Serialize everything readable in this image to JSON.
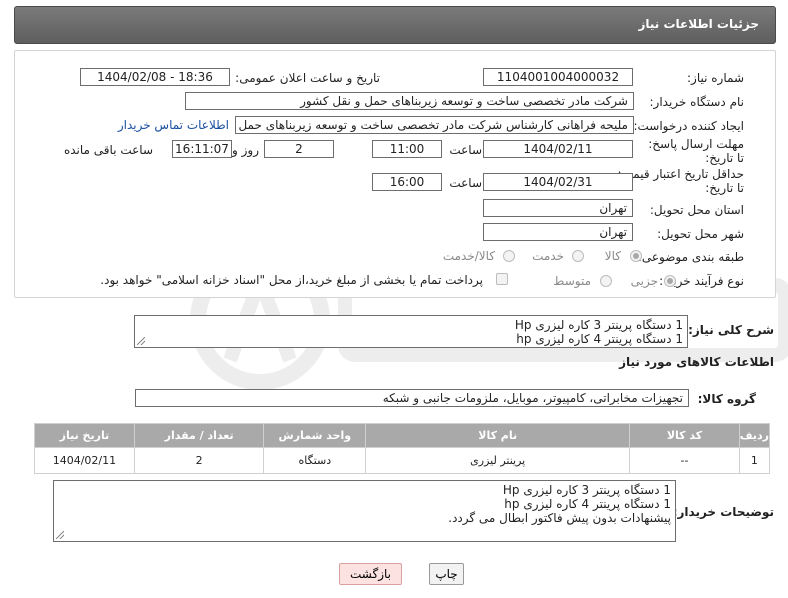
{
  "header": {
    "title": "جزئیات اطلاعات نیاز"
  },
  "labels": {
    "need_number": "شماره نیاز:",
    "announce_datetime": "تاریخ و ساعت اعلان عمومی:",
    "buyer_org": "نام دستگاه خریدار:",
    "requester": "ایجاد کننده درخواست:",
    "reply_deadline": "مهلت ارسال پاسخ: تا تاریخ:",
    "time": "ساعت",
    "days_and": "روز و",
    "hours_remaining": "ساعت باقی مانده",
    "price_validity": "حداقل تاریخ اعتبار قیمت: تا تاریخ:",
    "province": "استان محل تحویل:",
    "city": "شهر محل تحویل:",
    "category": "طبقه بندی موضوعی:",
    "process_type": "نوع فرآیند خرید :",
    "general_desc": "شرح کلی نیاز:",
    "goods_info": "اطلاعات کالاهای مورد نیاز",
    "goods_group": "گروه کالا:",
    "buyer_notes": "توضیحات خریدار:"
  },
  "values": {
    "need_number": "1104001004000032",
    "announce_datetime": "1404/02/08 - 18:36",
    "buyer_org": "شرکت مادر تخصصی ساخت و توسعه زیربناهای حمل و نقل کشور",
    "requester": "ملیحه فراهانی کارشناس شرکت مادر تخصصی ساخت و توسعه زیربناهای حمل و نقل",
    "contact_link": "اطلاعات تماس خریدار",
    "reply_date": "1404/02/11",
    "reply_time": "11:00",
    "days": "2",
    "remaining": "16:11:07",
    "validity_date": "1404/02/31",
    "validity_time": "16:00",
    "province": "تهران",
    "city": "تهران"
  },
  "category_options": [
    {
      "label": "کالا",
      "selected": true
    },
    {
      "label": "خدمت",
      "selected": false
    },
    {
      "label": "کالا/خدمت",
      "selected": false
    }
  ],
  "process_options": [
    {
      "label": "جزیی",
      "selected": true
    },
    {
      "label": "متوسط",
      "selected": false
    }
  ],
  "payment_note": "پرداخت تمام یا بخشی از مبلغ خرید،از محل \"اسناد خزانه اسلامی\" خواهد بود.",
  "general_desc_lines": [
    "1 دستگاه پرینتر 3 کاره لیزری Hp",
    "1 دستگاه پرینتر 4 کاره لیزری hp"
  ],
  "goods_group_value": "تجهیزات مخابراتی، کامپیوتر، موبایل، ملزومات جانبی و شبکه",
  "table": {
    "headers": [
      "ردیف",
      "کد کالا",
      "نام کالا",
      "واحد شمارش",
      "تعداد / مقدار",
      "تاریخ نیاز"
    ],
    "rows": [
      [
        "1",
        "--",
        "پرینتر لیزری",
        "دستگاه",
        "2",
        "1404/02/11"
      ]
    ]
  },
  "buyer_notes_lines": [
    "1 دستگاه پرینتر 3 کاره لیزری Hp",
    "1 دستگاه پرینتر 4 کاره لیزری hp",
    "پیشنهادات بدون پیش فاکتور ابطال می گردد."
  ],
  "buttons": {
    "print": "چاپ",
    "back": "بازگشت"
  },
  "colors": {
    "title_bg": "#6b6b6b",
    "table_header": "#a9a9a9",
    "link": "#1a4fa0",
    "back_button": "#fde2e2"
  }
}
